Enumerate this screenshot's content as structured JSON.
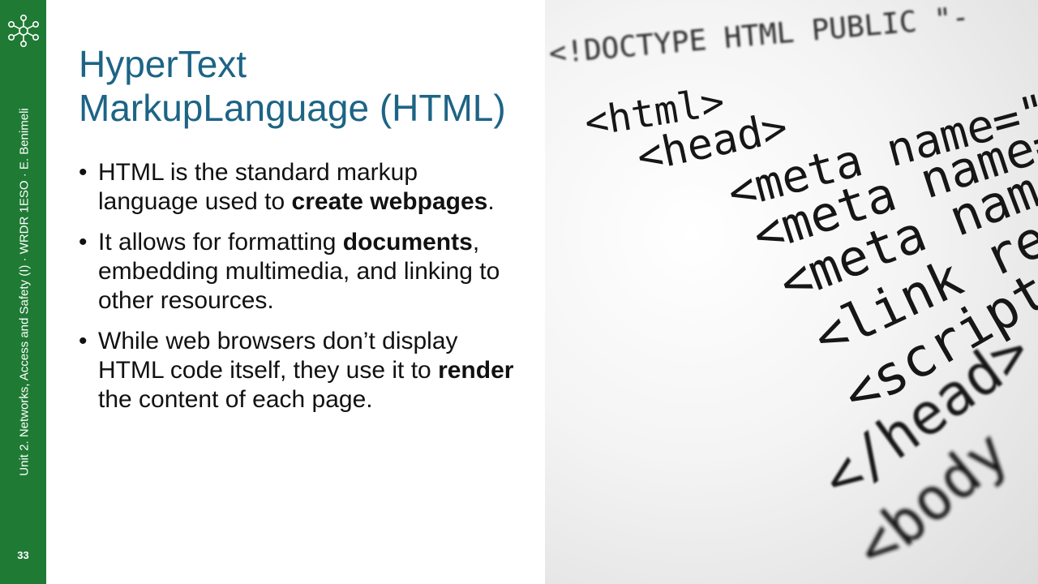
{
  "sidebar": {
    "caption": "Unit 2. Networks, Access and Safety (I) · WRDR 1ESO · E. Benimeli",
    "slide_number": "33",
    "icon": "network-icon",
    "band_color": "#1f7a34"
  },
  "title": {
    "line1": "HyperText",
    "line2": "MarkupLanguage (HTML)",
    "color": "#1d6485"
  },
  "bullets": [
    {
      "t1": "HTML is the standard markup language used to ",
      "b1": "create webpages",
      "t2": "."
    },
    {
      "t1": "It allows for formatting ",
      "b1": "documents",
      "t2": ", embedding multimedia, and linking to other resources."
    },
    {
      "t1": "While web browsers don’t display HTML code itself, they use it to ",
      "b1": "render",
      "t2": " the content of each page."
    }
  ],
  "photo": {
    "code_lines": [
      "<!DOCTYPE HTML PUBLIC \"-",
      "<html>",
      "<head>",
      "<meta name=\"T",
      "<meta name=",
      "<meta name",
      "<link re",
      "<script",
      "</head>",
      "<body"
    ]
  }
}
